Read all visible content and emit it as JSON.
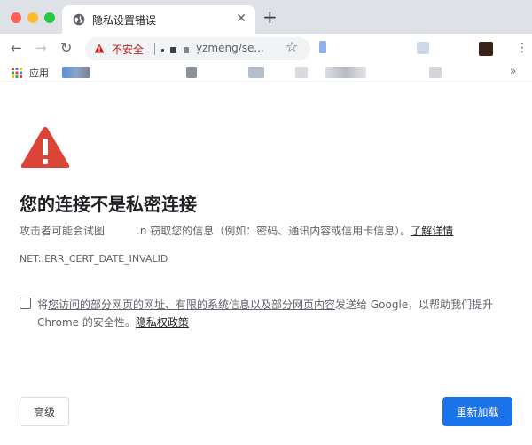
{
  "browser": {
    "tab": {
      "title": "隐私设置错误",
      "close_glyph": "✕"
    },
    "new_tab_glyph": "+",
    "nav": {
      "back_glyph": "←",
      "forward_glyph": "→",
      "reload_glyph": "↻"
    },
    "omnibox": {
      "security_label": "不安全",
      "url_visible": "yzmeng/se..."
    },
    "star_glyph": "☆",
    "menu_glyph": "⋮",
    "bookmarks": {
      "apps_label": "应用",
      "more_glyph": "»"
    }
  },
  "page": {
    "heading": "您的连接不是私密连接",
    "description": {
      "before": "攻击者可能会试图",
      "mid": ".n",
      "after": " 窃取您的信息（例如：密码、通讯内容或信用卡信息）。",
      "learn_more": "了解详情"
    },
    "error_code": "NET::ERR_CERT_DATE_INVALID",
    "optin": {
      "prefix": "将",
      "underlined": "您访问的部分网页的网址、有限的系统信息以及部分网页内容",
      "suffix": "发送给 Google，以帮助我们提升",
      "line2": "Chrome 的安全性。",
      "privacy_link": "隐私权政策",
      "checked": false
    },
    "buttons": {
      "advanced": "高级",
      "reload": "重新加载"
    }
  },
  "colors": {
    "accent": "#1a73e8",
    "danger": "#d93025",
    "not_secure": "#c5221f",
    "tabstrip": "#dee1e6"
  },
  "icons": [
    "globe-icon",
    "back-arrow-icon",
    "forward-arrow-icon",
    "reload-icon",
    "warning-triangle-icon",
    "star-icon",
    "menu-dots-icon",
    "apps-grid-icon",
    "danger-triangle-icon",
    "checkbox-icon"
  ]
}
